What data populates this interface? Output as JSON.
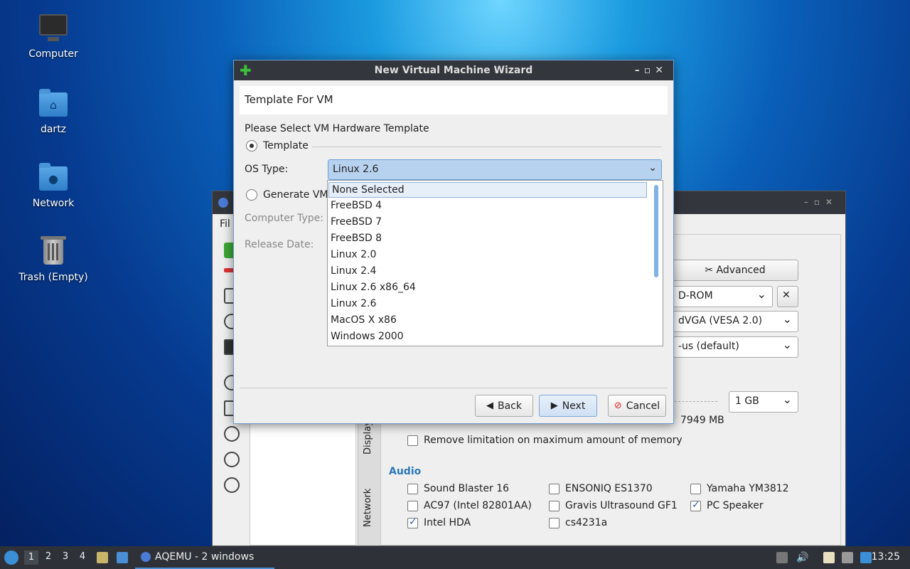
{
  "desktop": {
    "icons": [
      {
        "label": "Computer"
      },
      {
        "label": "dartz"
      },
      {
        "label": "Network"
      },
      {
        "label": "Trash (Empty)"
      }
    ]
  },
  "bg_window": {
    "menu_label": "Fil",
    "advanced_label": "Advanced",
    "cdrom_value": "D-ROM",
    "video_value": "dVGA (VESA 2.0)",
    "keyboard_value": "-us (default)",
    "memory_value": "1 GB",
    "memory_free": "7949 MB",
    "remove_limit_label": "Remove limitation on maximum amount of memory",
    "tab_display": "Display",
    "tab_network": "Network",
    "audio_title": "Audio",
    "audio_options": [
      {
        "label": "Sound Blaster 16",
        "checked": false
      },
      {
        "label": "ENSONIQ ES1370",
        "checked": false
      },
      {
        "label": "Yamaha YM3812",
        "checked": false
      },
      {
        "label": "AC97 (Intel 82801AA)",
        "checked": false
      },
      {
        "label": "Gravis Ultrasound GF1",
        "checked": false
      },
      {
        "label": "PC Speaker",
        "checked": true
      },
      {
        "label": "Intel HDA",
        "checked": true
      },
      {
        "label": "cs4231a",
        "checked": false
      }
    ]
  },
  "wizard": {
    "title": "New Virtual Machine Wizard",
    "header": "Template For VM",
    "prompt": "Please Select VM Hardware Template",
    "template_radio": "Template",
    "os_type_label": "OS Type:",
    "os_type_value": "Linux 2.6",
    "generate_radio": "Generate VM",
    "computer_type_label": "Computer Type:",
    "release_date_label": "Release Date:",
    "options": [
      "None Selected",
      "FreeBSD 4",
      "FreeBSD 7",
      "FreeBSD 8",
      "Linux 2.0",
      "Linux 2.4",
      "Linux 2.6 x86_64",
      "Linux 2.6",
      "MacOS X x86",
      "Windows 2000"
    ],
    "back_label": "Back",
    "next_label": "Next",
    "cancel_label": "Cancel"
  },
  "taskbar": {
    "workspaces": [
      "1",
      "2",
      "3",
      "4"
    ],
    "app_label": "AQEMU - 2 windows",
    "clock": "13:25"
  }
}
